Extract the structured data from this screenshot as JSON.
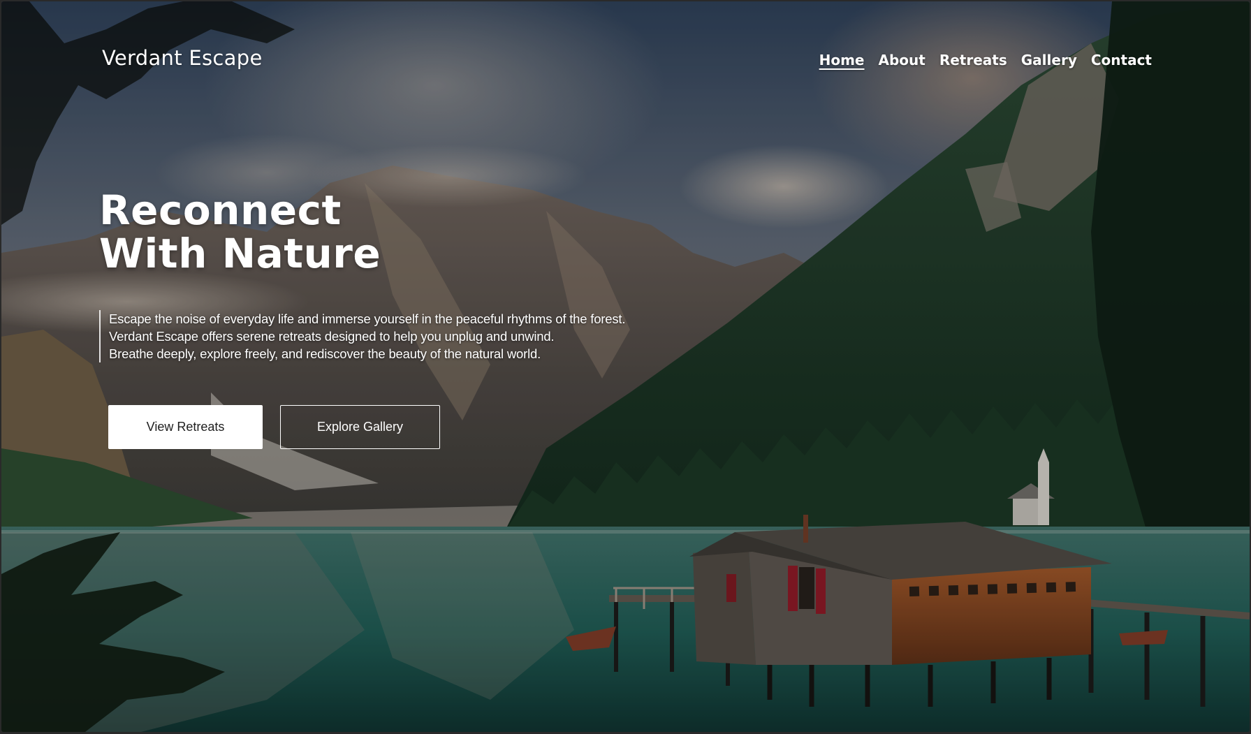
{
  "site": {
    "brand": "Verdant Escape"
  },
  "nav": {
    "items": [
      {
        "label": "Home",
        "active": true
      },
      {
        "label": "About",
        "active": false
      },
      {
        "label": "Retreats",
        "active": false
      },
      {
        "label": "Gallery",
        "active": false
      },
      {
        "label": "Contact",
        "active": false
      }
    ]
  },
  "hero": {
    "headline_line1": "Reconnect",
    "headline_line2": "With Nature",
    "intro_lines": [
      "Escape the noise of everyday life and immerse yourself in the peaceful rhythms of the forest.",
      "Verdant Escape offers serene retreats designed to help you unplug and unwind.",
      "Breathe deeply, explore freely, and rediscover the beauty of the natural world."
    ],
    "primary_button": "View Retreats",
    "secondary_button": "Explore Gallery"
  },
  "colors": {
    "text": "#ffffff",
    "primary_button_bg": "#ffffff",
    "primary_button_text": "#1e1e1e",
    "lake": "#1f6b62",
    "forest": "#1f3f2a",
    "cabin": "#8a4a22"
  }
}
